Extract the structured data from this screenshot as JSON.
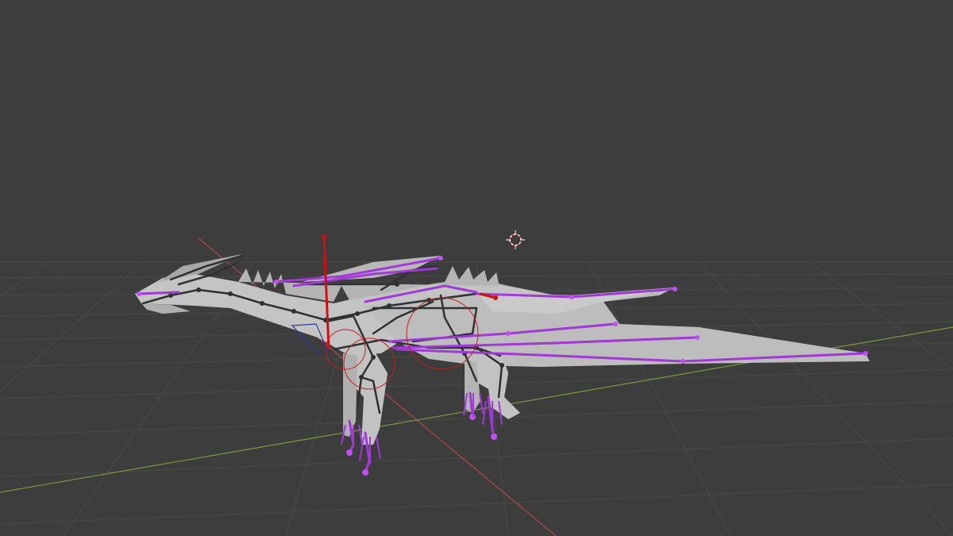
{
  "viewport": {
    "background": "#3d3d3d",
    "grid_color": "#4a4a4a",
    "x_axis_color": "#b04848",
    "y_axis_color": "#7a9a3a",
    "cursor_icon": "3d-cursor-icon"
  },
  "model": {
    "mesh_color": "#c4c4c4",
    "mesh_shadow": "#9a9a9a",
    "bone_color": "#2e3133",
    "selected_bone_color": "#a238d8",
    "active_bone_color": "#d01010",
    "ik_circle_color": "#c02020"
  }
}
